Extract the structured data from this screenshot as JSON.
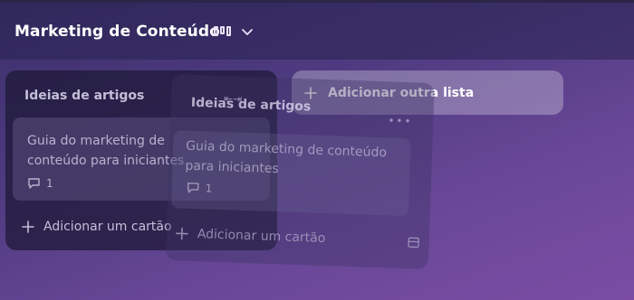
{
  "board": {
    "title": "Marketing de Conteúdo",
    "view_icon": "board-view-icon",
    "chevron_icon": "chevron-down-icon"
  },
  "lists": [
    {
      "title": "Ideias de artigos",
      "cards": [
        {
          "text": "Guia do marketing de conteúdo para iniciantes",
          "comments": "1"
        }
      ],
      "add_card_label": "Adicionar um cartão"
    }
  ],
  "add_list_label": "Adicionar outra lista",
  "drag_ghost": {
    "title": "Ideias de artigos",
    "card_text": "Guia do marketing de conteúdo para iniciantes",
    "comments": "1",
    "add_card_label": "Adicionar um cartão"
  },
  "colors": {
    "background_start": "#3b2f6a",
    "background_end": "#7a4ca4",
    "list_bg": "#1c1834",
    "text_primary": "#ffffff"
  }
}
